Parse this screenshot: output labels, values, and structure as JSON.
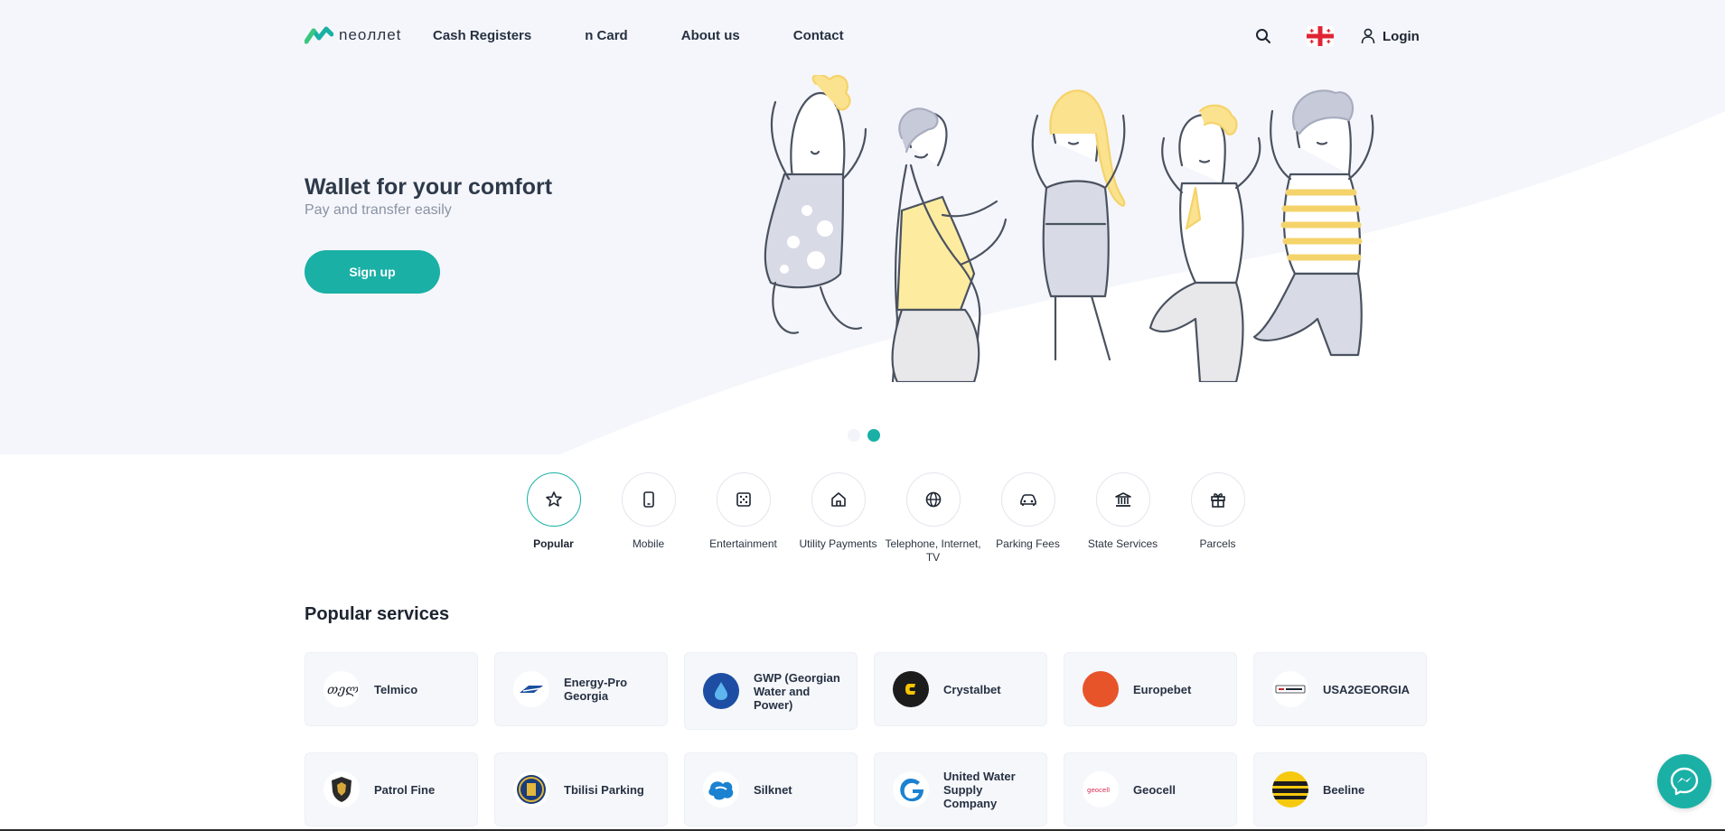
{
  "header": {
    "logo_text": "neoллet",
    "nav": [
      "Cash Registers",
      "n Card",
      "About us",
      "Contact"
    ],
    "login_label": "Login"
  },
  "hero": {
    "title": "Wallet for your comfort",
    "subtitle": "Pay and transfer easily",
    "cta_label": "Sign up",
    "carousel_active_index": 1,
    "carousel_count": 2
  },
  "categories": [
    {
      "label": "Popular",
      "icon": "star-icon",
      "active": true
    },
    {
      "label": "Mobile",
      "icon": "phone-icon",
      "active": false
    },
    {
      "label": "Entertainment",
      "icon": "dice-icon",
      "active": false
    },
    {
      "label": "Utility Payments",
      "icon": "house-icon",
      "active": false
    },
    {
      "label": "Telephone, Internet, TV",
      "icon": "globe-icon",
      "active": false
    },
    {
      "label": "Parking Fees",
      "icon": "car-icon",
      "active": false
    },
    {
      "label": "State Services",
      "icon": "bank-icon",
      "active": false
    },
    {
      "label": "Parcels",
      "icon": "gift-icon",
      "active": false
    }
  ],
  "popular": {
    "title": "Popular services",
    "services": [
      {
        "name": "Telmico",
        "logo": "telmico-logo"
      },
      {
        "name": "Energy-Pro Georgia",
        "logo": "energy-pro-logo"
      },
      {
        "name": "GWP (Georgian Water and Power)",
        "logo": "gwp-logo"
      },
      {
        "name": "Crystalbet",
        "logo": "crystalbet-logo"
      },
      {
        "name": "Europebet",
        "logo": "europebet-logo"
      },
      {
        "name": "USA2GEORGIA",
        "logo": "usa2georgia-logo"
      },
      {
        "name": "Patrol Fine",
        "logo": "patrol-logo"
      },
      {
        "name": "Tbilisi Parking",
        "logo": "tbilisi-parking-logo"
      },
      {
        "name": "Silknet",
        "logo": "silknet-logo"
      },
      {
        "name": "United Water Supply Company",
        "logo": "uwsc-logo"
      },
      {
        "name": "Geocell",
        "logo": "geocell-logo"
      },
      {
        "name": "Beeline",
        "logo": "beeline-logo"
      }
    ]
  },
  "colors": {
    "accent": "#1ab0a6",
    "hero_bg": "#f5f6fb",
    "text_dark": "#2e3a4a",
    "text_muted": "#8a93a3"
  }
}
